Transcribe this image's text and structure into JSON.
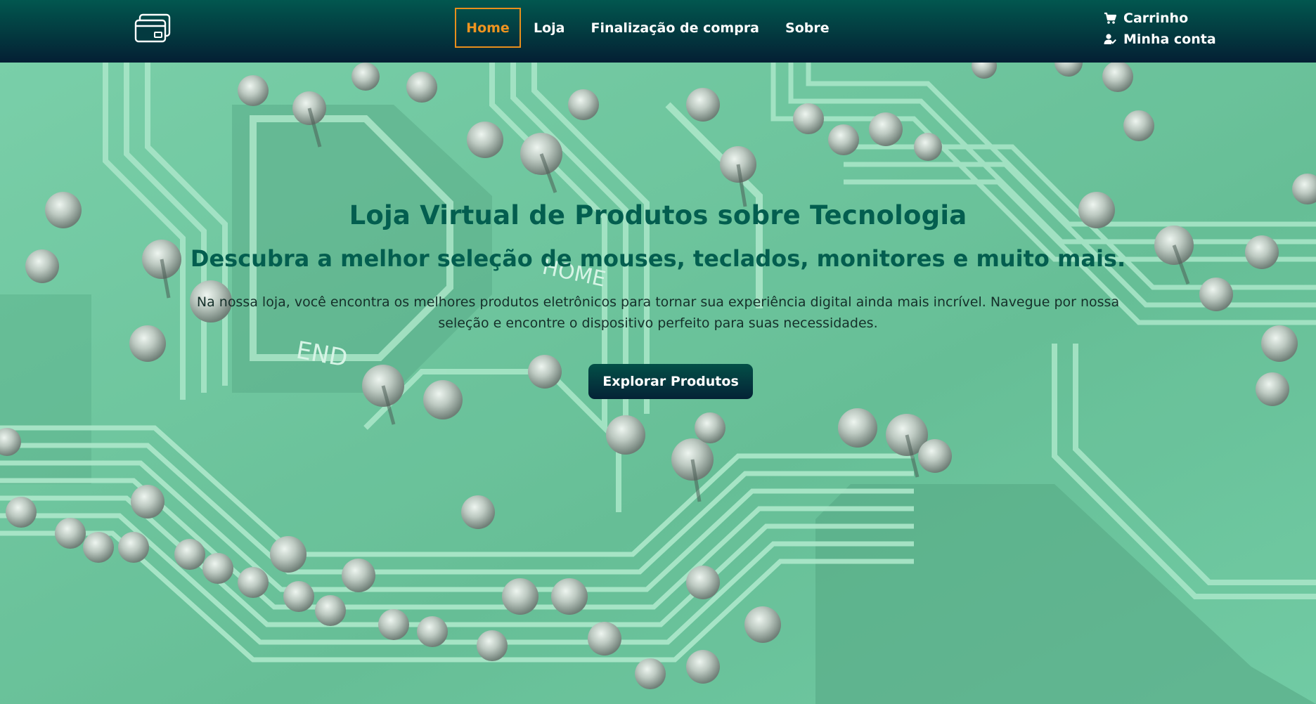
{
  "header": {
    "logo_icon": "credit-cards-icon",
    "nav": {
      "home": "Home",
      "loja": "Loja",
      "checkout": "Finalização de compra",
      "sobre": "Sobre"
    },
    "account": {
      "cart_label": "Carrinho",
      "cart_icon": "cart-icon",
      "account_label": "Minha conta",
      "account_icon": "user-check-icon"
    }
  },
  "hero": {
    "background_image": "green circuit board photo",
    "pcb_text_1": "HOME",
    "pcb_text_2": "END",
    "title": "Loja Virtual de Produtos sobre Tecnologia",
    "subtitle": "Descubra a melhor seleção de mouses, teclados, monitores e muito mais.",
    "description": "Na nossa loja, você encontra os melhores produtos eletrônicos para tornar sua experiência digital ainda mais incrível. Navegue por nossa seleção e encontre o dispositivo perfeito para suas necessidades.",
    "cta_label": "Explorar Produtos"
  },
  "colors": {
    "header_top": "#02574f",
    "header_bottom": "#041f34",
    "accent_active": "#ef9420",
    "title_color": "#035e4f",
    "pcb_green": "#56b98e"
  }
}
